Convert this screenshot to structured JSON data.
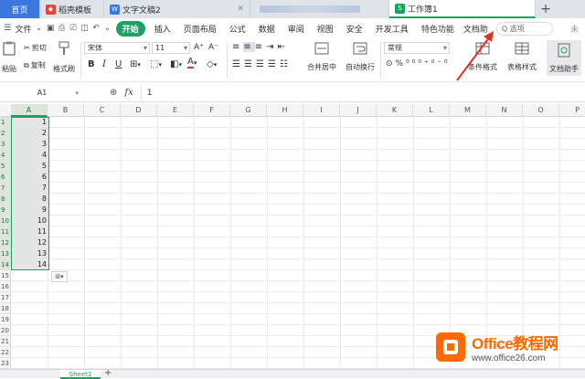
{
  "tabs": {
    "home": "首页",
    "template": "稻壳模板",
    "doc": "文字文稿2",
    "workbook": "工作簿1",
    "new_tab": "+"
  },
  "menu": {
    "file": "文件",
    "items": [
      "开始",
      "插入",
      "页面布局",
      "公式",
      "数据",
      "审阅",
      "视图",
      "安全",
      "开发工具",
      "特色功能",
      "文档助"
    ],
    "search_placeholder": "Q 选项",
    "more": "未"
  },
  "ribbon": {
    "cut": "剪切",
    "paste": "粘贴",
    "copy": "复制",
    "format_painter": "格式刷",
    "font_name": "宋体",
    "font_size": "11",
    "bold": "B",
    "italic": "I",
    "underline": "U",
    "font_color": "A",
    "merge_center": "合并居中",
    "wrap_text": "自动换行",
    "number_format": "常规",
    "conditional_format": "条件格式",
    "table_style": "表格样式",
    "doc_assistant": "文档助手"
  },
  "formula_bar": {
    "cell_ref": "A1",
    "fx": "fx",
    "value": "1"
  },
  "grid": {
    "columns": [
      "A",
      "B",
      "C",
      "D",
      "E",
      "F",
      "G",
      "H",
      "I",
      "J",
      "K",
      "L",
      "M",
      "N",
      "O",
      "P"
    ],
    "rows": [
      "1",
      "2",
      "3",
      "4",
      "5",
      "6",
      "7",
      "8",
      "9",
      "10",
      "11",
      "12",
      "13",
      "14",
      "15",
      "16",
      "17",
      "18",
      "19",
      "20",
      "21",
      "22",
      "23"
    ],
    "column_a_values": [
      "1",
      "2",
      "3",
      "4",
      "5",
      "6",
      "7",
      "8",
      "9",
      "10",
      "11",
      "12",
      "13",
      "14"
    ],
    "selected_column": "A"
  },
  "sheets": {
    "active": "Sheet1",
    "add": "+"
  },
  "watermark": {
    "line1": "Office教程网",
    "line2": "www.office26.com"
  },
  "colors": {
    "accent_green": "#1aa260",
    "home_tab_blue": "#3a78e0",
    "arrow_red": "#e0302a",
    "watermark_orange": "#ff6a00"
  }
}
